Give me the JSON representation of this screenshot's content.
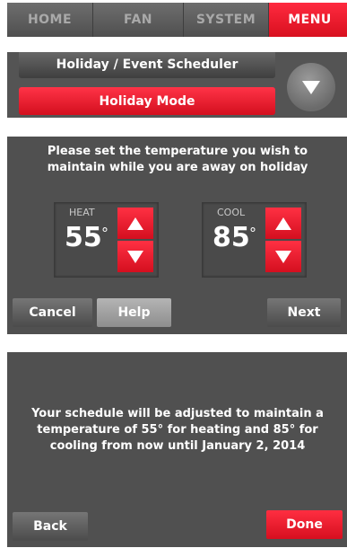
{
  "nav": {
    "tabs": [
      {
        "label": "HOME",
        "active": false
      },
      {
        "label": "FAN",
        "active": false
      },
      {
        "label": "SYSTEM",
        "active": false
      },
      {
        "label": "MENU",
        "active": true
      }
    ]
  },
  "menu": {
    "items": [
      {
        "label": "Holiday / Event Scheduler",
        "selected": false
      },
      {
        "label": "Holiday Mode",
        "selected": true
      }
    ],
    "scroll_icon": "chevron-down-icon"
  },
  "holiday_temp": {
    "prompt_lines": [
      "Please set the temperature you wish to",
      "maintain while you are away on holiday"
    ],
    "heat": {
      "label": "HEAT",
      "value": "55",
      "degree": "°"
    },
    "cool": {
      "label": "COOL",
      "value": "85",
      "degree": "°"
    },
    "buttons": {
      "cancel": "Cancel",
      "help": "Help",
      "next": "Next"
    }
  },
  "confirmation": {
    "message_lines": [
      "Your schedule will be adjusted to maintain a",
      "temperature of 55° for heating and 85° for",
      "cooling from now until January 2, 2014"
    ],
    "buttons": {
      "back": "Back",
      "done": "Done"
    }
  },
  "colors": {
    "accent_red": "#e8172b",
    "panel_gray": "#505050",
    "nav_gray": "#5a5a5a"
  }
}
